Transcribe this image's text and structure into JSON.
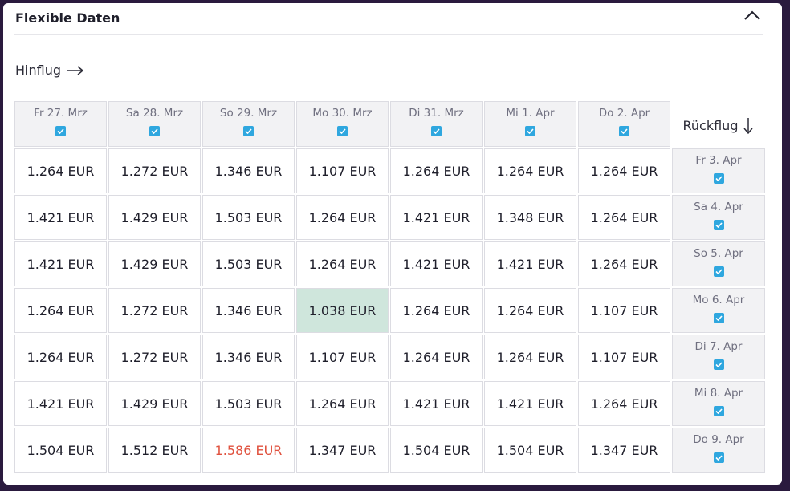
{
  "header": {
    "title": "Flexible Daten"
  },
  "outbound_label": "Hinflug",
  "return_label": "Rückflug",
  "columns": [
    "Fr 27. Mrz",
    "Sa 28. Mrz",
    "So 29. Mrz",
    "Mo 30. Mrz",
    "Di 31. Mrz",
    "Mi 1. Apr",
    "Do 2. Apr"
  ],
  "rows": [
    {
      "date": "Fr 3. Apr",
      "prices": [
        "1.264 EUR",
        "1.272 EUR",
        "1.346 EUR",
        "1.107 EUR",
        "1.264 EUR",
        "1.264 EUR",
        "1.264 EUR"
      ]
    },
    {
      "date": "Sa 4. Apr",
      "prices": [
        "1.421 EUR",
        "1.429 EUR",
        "1.503 EUR",
        "1.264 EUR",
        "1.421 EUR",
        "1.348 EUR",
        "1.264 EUR"
      ]
    },
    {
      "date": "So 5. Apr",
      "prices": [
        "1.421 EUR",
        "1.429 EUR",
        "1.503 EUR",
        "1.264 EUR",
        "1.421 EUR",
        "1.421 EUR",
        "1.264 EUR"
      ]
    },
    {
      "date": "Mo 6. Apr",
      "prices": [
        "1.264 EUR",
        "1.272 EUR",
        "1.346 EUR",
        "1.038 EUR",
        "1.264 EUR",
        "1.264 EUR",
        "1.107 EUR"
      ]
    },
    {
      "date": "Di 7. Apr",
      "prices": [
        "1.264 EUR",
        "1.272 EUR",
        "1.346 EUR",
        "1.107 EUR",
        "1.264 EUR",
        "1.264 EUR",
        "1.107 EUR"
      ]
    },
    {
      "date": "Mi 8. Apr",
      "prices": [
        "1.421 EUR",
        "1.429 EUR",
        "1.503 EUR",
        "1.264 EUR",
        "1.421 EUR",
        "1.421 EUR",
        "1.264 EUR"
      ]
    },
    {
      "date": "Do 9. Apr",
      "prices": [
        "1.504 EUR",
        "1.512 EUR",
        "1.586 EUR",
        "1.347 EUR",
        "1.504 EUR",
        "1.504 EUR",
        "1.347 EUR"
      ]
    }
  ],
  "best_price": "1.038 EUR",
  "highest_price": "1.586 EUR",
  "colors": {
    "best_bg": "#cfe6dc",
    "highest_text": "#e0523f",
    "checkbox": "#2fa7df"
  },
  "icons": {
    "collapse": "chevron-up-icon",
    "outbound": "arrow-right-icon",
    "return": "arrow-down-icon",
    "checkbox": "checkbox-checked-icon"
  }
}
